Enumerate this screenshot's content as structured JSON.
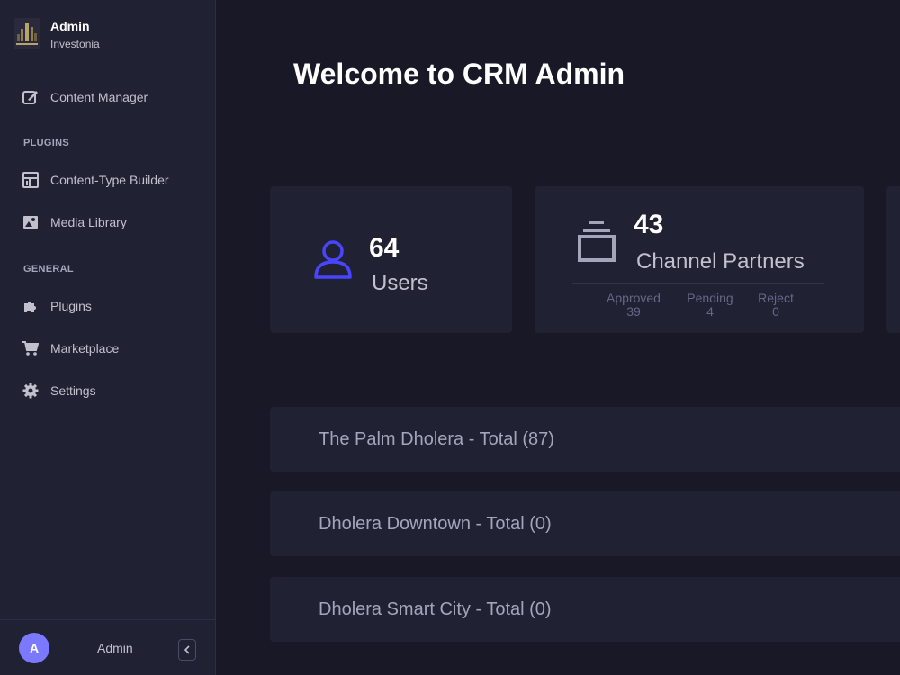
{
  "sidebar": {
    "brand_title": "Admin",
    "brand_subtitle": "Investonia",
    "items": {
      "content_manager": "Content Manager",
      "content_type_builder": "Content-Type Builder",
      "media_library": "Media Library",
      "plugins": "Plugins",
      "marketplace": "Marketplace",
      "settings": "Settings"
    },
    "sections": {
      "plugins": "PLUGINS",
      "general": "GENERAL"
    },
    "footer": {
      "avatar_initial": "A",
      "user_name": "Admin"
    }
  },
  "main": {
    "title": "Welcome to CRM Admin",
    "users_card": {
      "count": "64",
      "label": "Users"
    },
    "partners_card": {
      "count": "43",
      "label": "Channel Partners",
      "stats": [
        {
          "label": "Approved",
          "value": "39"
        },
        {
          "label": "Pending",
          "value": "4"
        },
        {
          "label": "Reject",
          "value": "0"
        }
      ]
    },
    "projects": [
      "The Palm Dholera - Total (87)",
      "Dholera Downtown - Total (0)",
      "Dholera Smart City - Total (0)"
    ]
  },
  "colors": {
    "background": "#181826",
    "panel": "#212134",
    "accent": "#4945ff",
    "avatar": "#7b79ff"
  },
  "icons": {
    "content_manager": "feather-pen-icon",
    "content_type_builder": "layout-icon",
    "media_library": "image-icon",
    "plugins": "puzzle-icon",
    "marketplace": "cart-icon",
    "settings": "gear-icon",
    "users": "user-icon",
    "partners": "stack-icon"
  }
}
